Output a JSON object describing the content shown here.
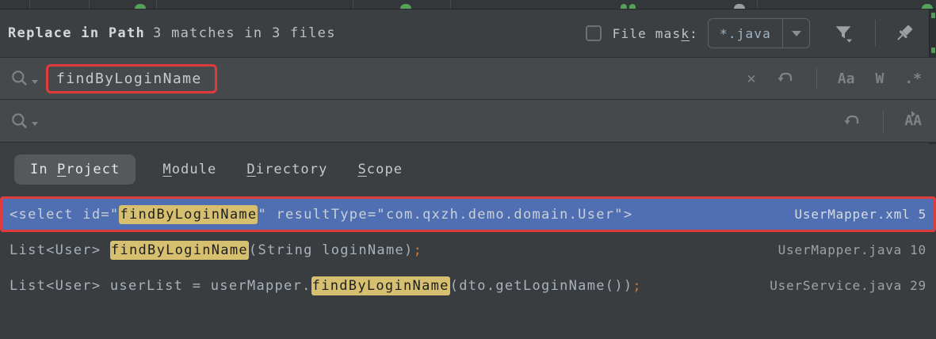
{
  "header": {
    "title": "Replace in Path",
    "summary": "3 matches in 3 files",
    "file_mask": {
      "label_pre": "File mas",
      "label_accel": "k",
      "label_post": ":",
      "checked": false,
      "value": "*.java"
    }
  },
  "search": {
    "query": "findByLoginName",
    "options": {
      "match_case": "Aa",
      "words": "W",
      "regex": ".*"
    }
  },
  "replace": {
    "value": "",
    "preserve_case": "AA"
  },
  "icons": {
    "clear": "✕"
  },
  "scope_tabs": [
    {
      "pre": "In ",
      "accel": "P",
      "post": "roject",
      "selected": true
    },
    {
      "pre": "",
      "accel": "M",
      "post": "odule",
      "selected": false
    },
    {
      "pre": "",
      "accel": "D",
      "post": "irectory",
      "selected": false
    },
    {
      "pre": "",
      "accel": "S",
      "post": "cope",
      "selected": false
    }
  ],
  "results": {
    "rows": [
      {
        "selected": true,
        "annotated": true,
        "segments": [
          {
            "text": "<select id=\"",
            "style": "code"
          },
          {
            "text": "findByLoginName",
            "style": "match"
          },
          {
            "text": "\" resultType=\"com.qxzh.demo.domain.User\">",
            "style": "code"
          }
        ],
        "file": "UserMapper.xml",
        "line": "5"
      },
      {
        "selected": false,
        "annotated": false,
        "segments": [
          {
            "text": "List<User> ",
            "style": "code"
          },
          {
            "text": "findByLoginName",
            "style": "match"
          },
          {
            "text": "(String loginName)",
            "style": "code"
          },
          {
            "text": ";",
            "style": "punct"
          }
        ],
        "file": "UserMapper.java",
        "line": "10"
      },
      {
        "selected": false,
        "annotated": false,
        "segments": [
          {
            "text": "List<User> userList = userMapper.",
            "style": "code"
          },
          {
            "text": "findByLoginName",
            "style": "match"
          },
          {
            "text": "(dto.getLoginName())",
            "style": "code"
          },
          {
            "text": ";",
            "style": "punct"
          }
        ],
        "file": "UserService.java",
        "line": "29"
      }
    ]
  },
  "colors": {
    "selection_blue": "#4F6FB2",
    "match_highlight": "#D6BF6E",
    "annotation_red": "#E03B3B",
    "punct_orange": "#CC7832",
    "dialog_bg": "#3C3F41",
    "field_bg": "#46494B"
  }
}
